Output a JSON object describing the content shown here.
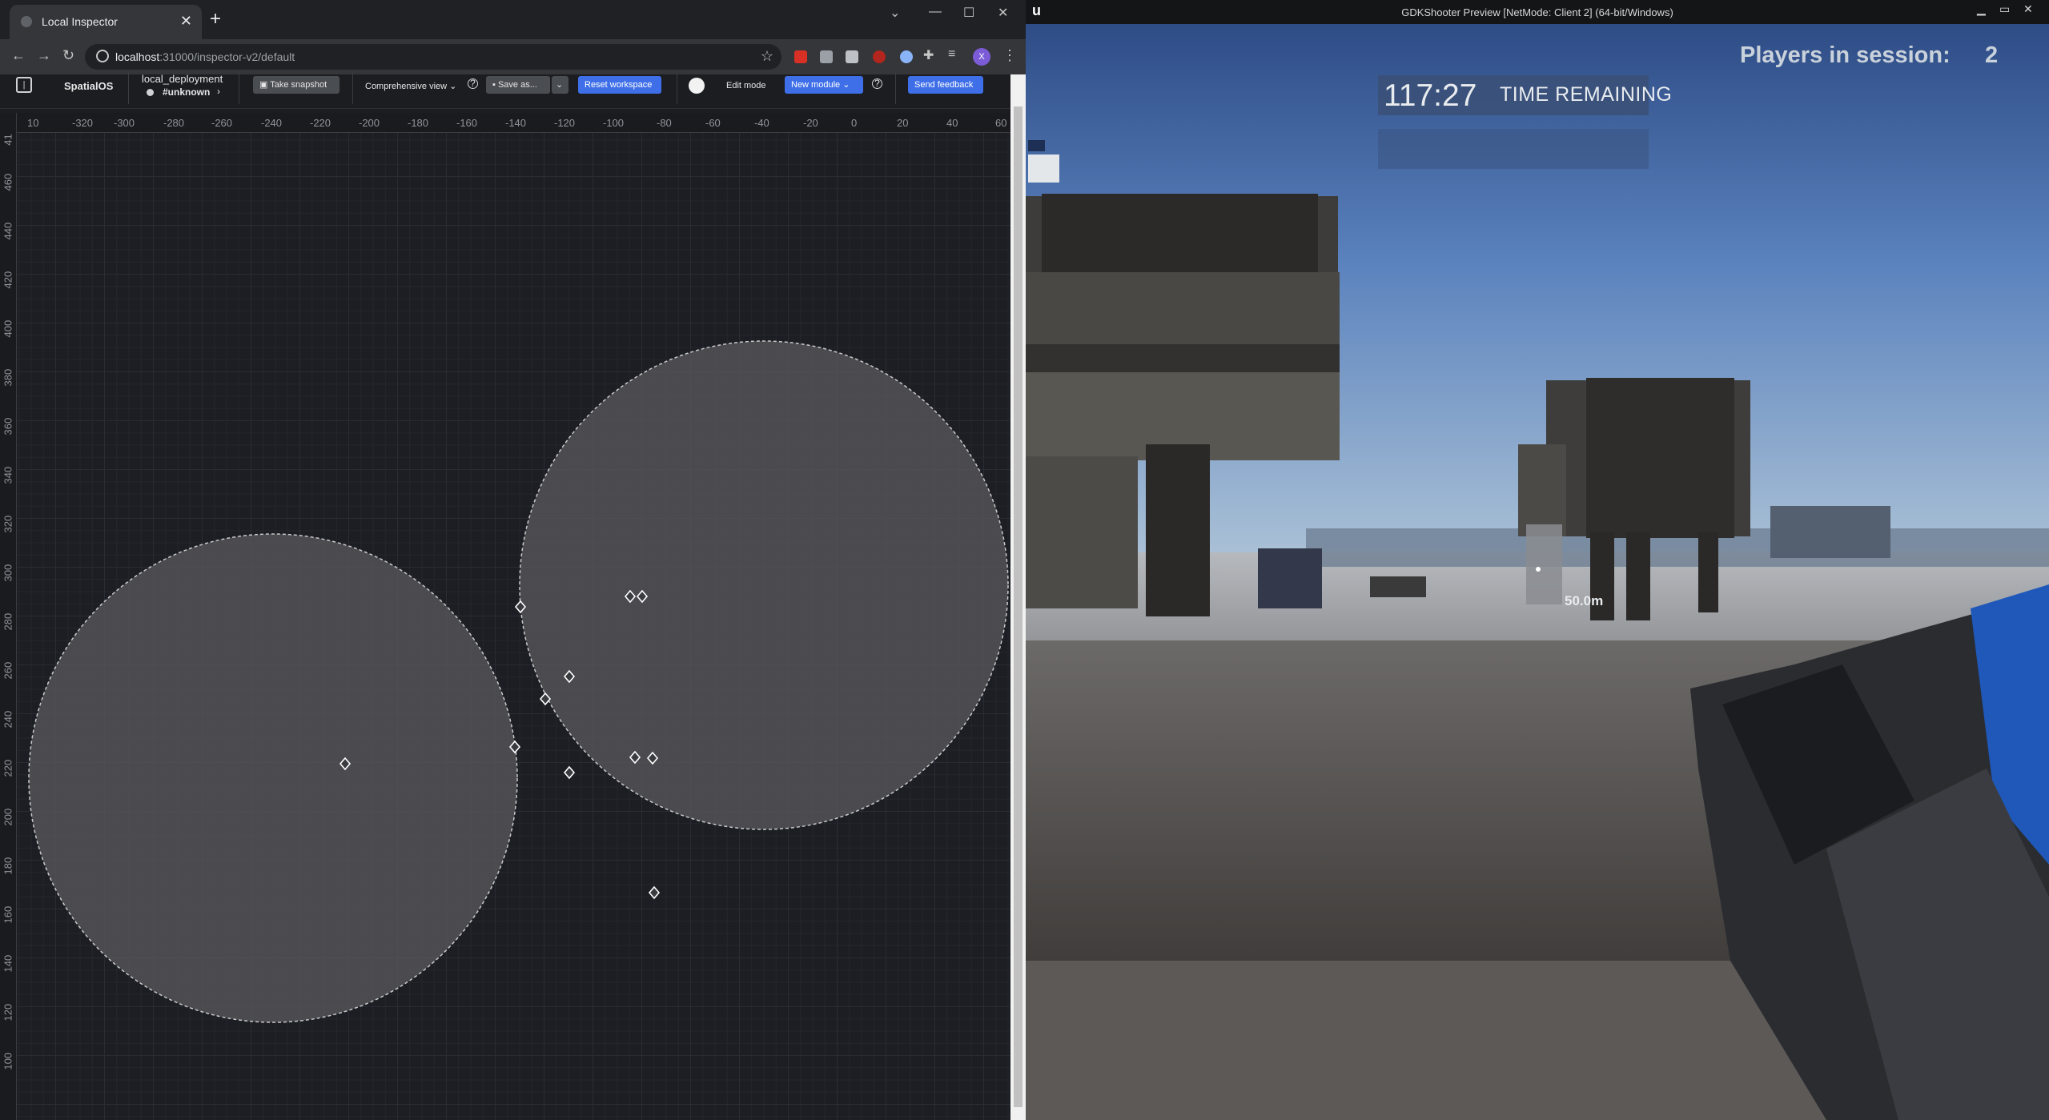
{
  "browser": {
    "tab_title": "Local Inspector",
    "url_host": "localhost",
    "url_path": ":31000/inspector-v2/default",
    "avatar_initial": "X"
  },
  "inspector": {
    "brand": "SpatialOS",
    "deployment_name": "local_deployment",
    "deployment_status": "#unknown",
    "take_snapshot": "Take snapshot",
    "view_select": "Comprehensive view",
    "save_as": "Save as...",
    "reset_workspace": "Reset workspace",
    "edit_mode": "Edit mode",
    "new_module": "New module",
    "send_feedback": "Send feedback",
    "x_ticks": [
      "10",
      "-320",
      "-300",
      "-280",
      "-260",
      "-240",
      "-220",
      "-200",
      "-180",
      "-160",
      "-140",
      "-120",
      "-100",
      "-80",
      "-60",
      "-40",
      "-20",
      "0",
      "20",
      "40",
      "60"
    ],
    "y_ticks": [
      "41",
      "460",
      "440",
      "420",
      "400",
      "380",
      "360",
      "340",
      "320",
      "300",
      "280",
      "260",
      "240",
      "220",
      "200",
      "180",
      "160",
      "140",
      "120",
      "100"
    ]
  },
  "game": {
    "window_title": "GDKShooter Preview [NetMode: Client 2] (64-bit/Windows)",
    "players_label": "Players in session:",
    "players_count": "2",
    "timer": "117:27",
    "timer_label": "TIME REMAINING",
    "distance_marker": "50.0m"
  },
  "colors": {
    "accent_blue": "#3f6fe8",
    "chrome_dark": "#202124",
    "map_bg": "#1d1e24",
    "circle_fill": "#5b5c60",
    "sky": "#4f78b5"
  }
}
